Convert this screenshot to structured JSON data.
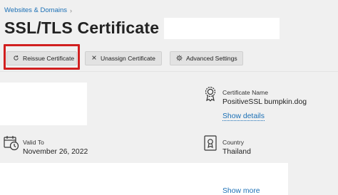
{
  "breadcrumb": {
    "item": "Websites & Domains",
    "separator": "›"
  },
  "page": {
    "title": "SSL/TLS Certificate for"
  },
  "toolbar": {
    "reissue_label": "Reissue Certificate",
    "unassign_label": "Unassign Certificate",
    "advanced_label": "Advanced Settings"
  },
  "details": {
    "certificate_name_label": "Certificate Name",
    "certificate_name_value": "PositiveSSL bumpkin.dog",
    "show_details_link": "Show details",
    "valid_to_label": "Valid To",
    "valid_to_value": "November 26, 2022",
    "country_label": "Country",
    "country_value": "Thailand",
    "show_more_link": "Show more"
  },
  "colors": {
    "link": "#1a6fb5",
    "highlight": "#d11f1f",
    "button_bg": "#e2e2e2"
  }
}
